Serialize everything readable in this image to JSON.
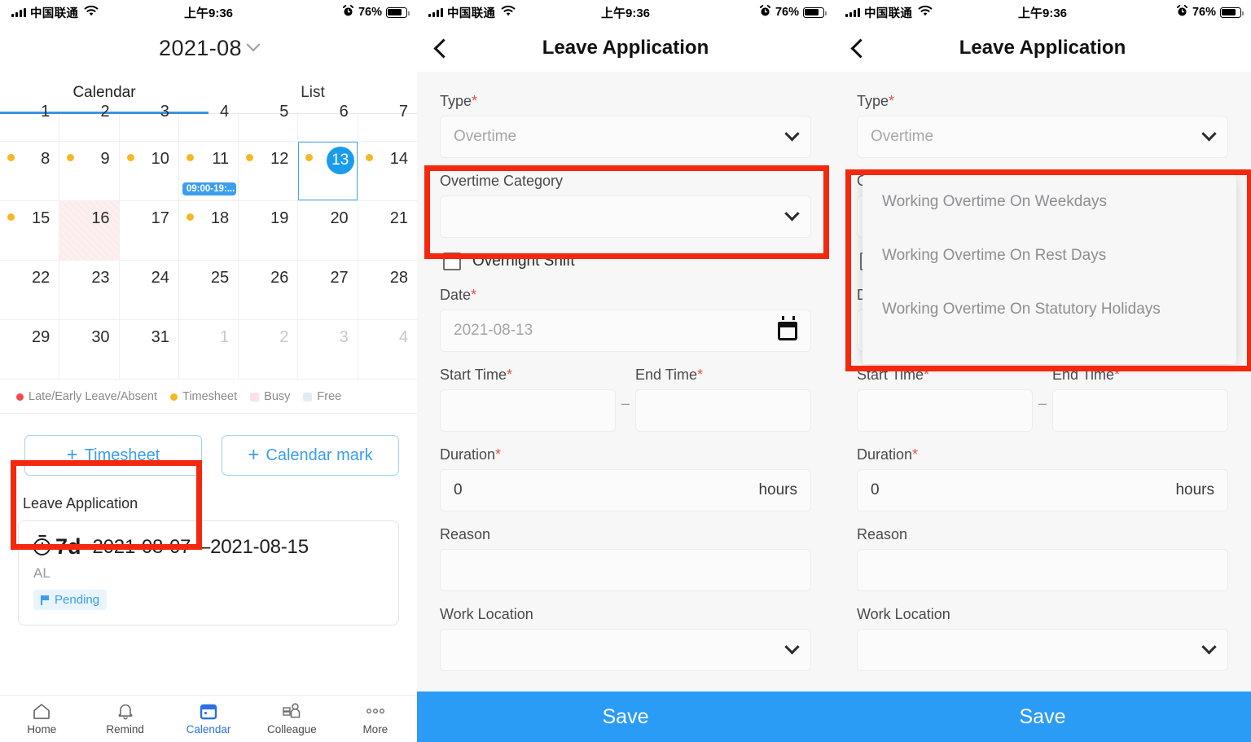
{
  "status_bar": {
    "carrier": "中国联通",
    "time": "上午9:36",
    "battery_pct": "76%"
  },
  "panel_calendar": {
    "month_title": "2021-08",
    "tabs": [
      {
        "label": "Calendar",
        "active": true
      },
      {
        "label": "List",
        "active": false
      }
    ],
    "weeks": [
      {
        "clipped": true,
        "days": [
          {
            "n": "1",
            "dot": false
          },
          {
            "n": "2",
            "dot": false
          },
          {
            "n": "3",
            "dot": false
          },
          {
            "n": "4",
            "dot": false
          },
          {
            "n": "5",
            "dot": false
          },
          {
            "n": "6",
            "dot": false
          },
          {
            "n": "7",
            "dot": false
          }
        ]
      },
      {
        "clipped": false,
        "days": [
          {
            "n": "8",
            "dot": true
          },
          {
            "n": "9",
            "dot": true
          },
          {
            "n": "10",
            "dot": true
          },
          {
            "n": "11",
            "dot": true,
            "event": "09:00-19:..."
          },
          {
            "n": "12",
            "dot": true
          },
          {
            "n": "13",
            "dot": true,
            "selected": true
          },
          {
            "n": "14",
            "dot": true
          }
        ]
      },
      {
        "clipped": false,
        "days": [
          {
            "n": "15",
            "dot": true
          },
          {
            "n": "16",
            "dot": false,
            "busy": true
          },
          {
            "n": "17",
            "dot": false
          },
          {
            "n": "18",
            "dot": true
          },
          {
            "n": "19",
            "dot": false
          },
          {
            "n": "20",
            "dot": false
          },
          {
            "n": "21",
            "dot": false
          }
        ]
      },
      {
        "clipped": false,
        "days": [
          {
            "n": "22",
            "dot": false
          },
          {
            "n": "23",
            "dot": false
          },
          {
            "n": "24",
            "dot": false
          },
          {
            "n": "25",
            "dot": false
          },
          {
            "n": "26",
            "dot": false
          },
          {
            "n": "27",
            "dot": false
          },
          {
            "n": "28",
            "dot": false
          }
        ]
      },
      {
        "clipped": false,
        "days": [
          {
            "n": "29",
            "dot": false
          },
          {
            "n": "30",
            "dot": false
          },
          {
            "n": "31",
            "dot": false
          },
          {
            "n": "1",
            "dot": false,
            "muted": true
          },
          {
            "n": "2",
            "dot": false,
            "muted": true
          },
          {
            "n": "3",
            "dot": false,
            "muted": true
          },
          {
            "n": "4",
            "dot": false,
            "muted": true
          }
        ]
      }
    ],
    "legend": [
      {
        "label": "Late/Early Leave/Absent",
        "color": "#f04b4b",
        "shape": "dot"
      },
      {
        "label": "Timesheet",
        "color": "#f5b824",
        "shape": "dot"
      },
      {
        "label": "Busy",
        "color": "#fbe3e3",
        "shape": "square"
      },
      {
        "label": "Free",
        "color": "#e4ebf7",
        "shape": "square"
      }
    ],
    "actions": [
      {
        "label": "Timesheet",
        "plus": "+"
      },
      {
        "label": "Calendar mark",
        "plus": "+"
      }
    ],
    "leave_section_label": "Leave Application",
    "leave_card": {
      "days": "7d",
      "range": "2021-08-07—2021-08-15",
      "type": "AL",
      "status": "Pending"
    },
    "tabbar": [
      {
        "label": "Home",
        "icon": "home-icon",
        "active": false
      },
      {
        "label": "Remind",
        "icon": "bell-icon",
        "active": false
      },
      {
        "label": "Calendar",
        "icon": "calendar-icon",
        "active": true
      },
      {
        "label": "Colleague",
        "icon": "people-icon",
        "active": false
      },
      {
        "label": "More",
        "icon": "more-icon",
        "active": false
      }
    ],
    "colors": {
      "accent": "#3b9eef",
      "selected": "#1a9cec",
      "timesheet_dot": "#f5b824"
    }
  },
  "panel_form": {
    "nav_title": "Leave Application",
    "fields": {
      "type_label": "Type",
      "type_value": "Overtime",
      "category_label": "Overtime Category",
      "category_value": "",
      "overnight_label": "Overnight Shift",
      "date_label": "Date",
      "date_value": "2021-08-13",
      "start_label": "Start Time",
      "start_value": "",
      "end_label": "End Time",
      "end_value": "",
      "separator": "–",
      "duration_label": "Duration",
      "duration_value": "0",
      "duration_unit": "hours",
      "reason_label": "Reason",
      "reason_value": "",
      "worklocation_label": "Work Location",
      "worklocation_value": ""
    },
    "save_label": "Save"
  },
  "panel_dropdown": {
    "nav_title": "Leave Application",
    "options": [
      "Working Overtime On Weekdays",
      "Working Overtime On Rest Days",
      "Working Overtime On Statutory Holidays"
    ],
    "save_label": "Save"
  },
  "annotation": {
    "color": "#f4280f"
  }
}
